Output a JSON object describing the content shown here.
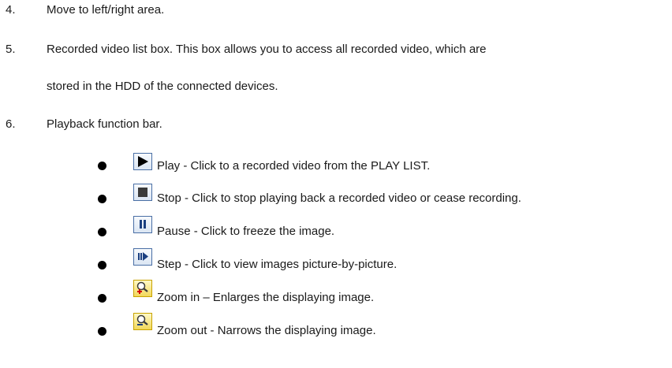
{
  "items": [
    {
      "number": "4.",
      "text": "Move to left/right area."
    },
    {
      "number": "5.",
      "text_line1": "Recorded video list box. This box allows you to access all recorded video, which are",
      "text_line2": "stored in the HDD of the connected devices."
    },
    {
      "number": "6.",
      "text": "Playback function bar."
    }
  ],
  "functions": [
    {
      "icon": "play-icon",
      "text": "Play - Click to a recorded video from the PLAY LIST."
    },
    {
      "icon": "stop-icon",
      "text": "Stop - Click to stop playing back a recorded video or cease recording."
    },
    {
      "icon": "pause-icon",
      "text": "Pause - Click to freeze the image."
    },
    {
      "icon": "step-icon",
      "text": "Step - Click to view images picture-by-picture."
    },
    {
      "icon": "zoom-in-icon",
      "text": "Zoom in – Enlarges the displaying image."
    },
    {
      "icon": "zoom-out-icon",
      "text": "Zoom out - Narrows the displaying image."
    }
  ]
}
